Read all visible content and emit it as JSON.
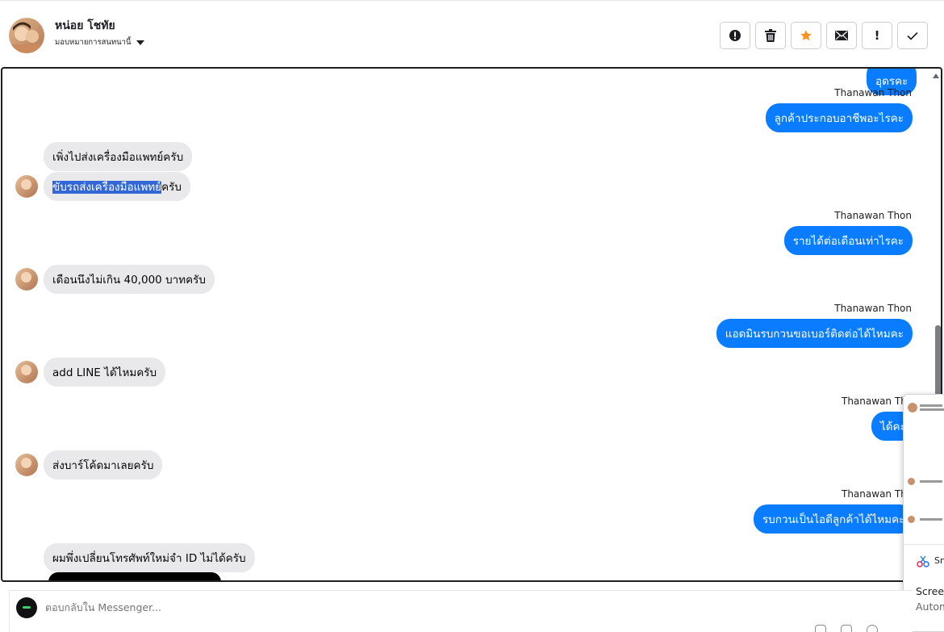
{
  "header": {
    "contact_name": "หน่อย โชทัย",
    "assign_label": "มอบหมายการสนทนานี้"
  },
  "toolbar": [
    {
      "name": "spam",
      "icon": "alert-circle-icon"
    },
    {
      "name": "delete",
      "icon": "trash-icon"
    },
    {
      "name": "star",
      "icon": "star-icon"
    },
    {
      "name": "mark-unread",
      "icon": "envelope-icon"
    },
    {
      "name": "follow-up",
      "icon": "exclamation-icon",
      "glyph": "!"
    },
    {
      "name": "done",
      "icon": "check-icon"
    }
  ],
  "messages": {
    "out_0": "อุดรคะ",
    "sender_1": "Thanawan Thon",
    "out_1": "ลูกค้าประกอบอาชีพอะไรคะ",
    "in_1": "เพิ่งไปส่งเครื่องมือแพทย์ครับ",
    "in_2_highlight": "ขับรถส่งเครื่องมือแพทย์",
    "in_2_rest": "ครับ",
    "sender_2": "Thanawan Thon",
    "out_2": "รายได้ต่อเดือนเท่าไรคะ",
    "in_3": "เดือนนึงไม่เกิน 40,000 บาทครับ",
    "sender_3": "Thanawan Thon",
    "out_3": "แอดมินรบกวนขอเบอร์ติดต่อได้ไหมคะ",
    "in_4": "add LINE ได้ไหมครับ",
    "sender_4": "Thanawan Thor",
    "out_4": "ได้คะ",
    "in_5": "ส่งบาร์โค้ดมาเลยครับ",
    "sender_5": "Thanawan Tho",
    "out_5": "รบกวนเป็นไอดีลูกค้าได้ไหมคะ",
    "in_6": "ผมพึ่งเปลี่ยนโทรศัพท์ใหม่จำ ID ไม่ได้ครับ"
  },
  "side_popup": {
    "snip_label": "Sn",
    "screen_label": "Screen",
    "auto_label": "Autom"
  },
  "composer": {
    "placeholder": "ตอบกลับใน Messenger..."
  },
  "colors": {
    "outgoing_bubble": "#0a7cff",
    "incoming_bubble": "#e9e9eb",
    "star": "#f7931e"
  }
}
